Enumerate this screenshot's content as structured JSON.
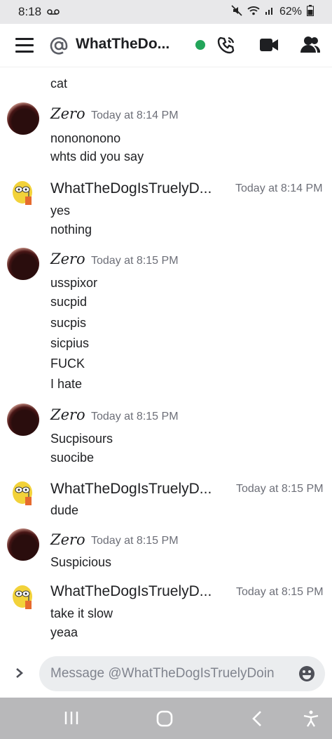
{
  "status": {
    "time": "8:18",
    "battery": "62%",
    "icons": [
      "voicemail-icon",
      "mute-icon",
      "wifi-icon",
      "signal-icon",
      "battery-icon"
    ]
  },
  "header": {
    "title": "WhatTheDo...",
    "status_color": "#23a55a",
    "icons": [
      "menu-icon",
      "at-icon",
      "call-icon",
      "video-icon",
      "members-icon"
    ]
  },
  "partial_top_line": "cat",
  "messages": [
    {
      "username": "Zero",
      "timestamp": "Today at 8:14 PM",
      "lines": [
        "nonononono",
        "whts did you say"
      ]
    },
    {
      "username": "WhatTheDogIsTruelyD...",
      "timestamp": "Today at 8:14 PM",
      "lines": [
        "yes",
        "nothing"
      ]
    },
    {
      "username": "Zero",
      "timestamp": "Today at 8:15 PM",
      "lines": [
        "usspixor",
        "sucpid",
        "sucpis",
        "sicpius",
        "FUCK",
        "I hate"
      ]
    },
    {
      "username": "Zero",
      "timestamp": "Today at 8:15 PM",
      "lines": [
        "Sucpisours",
        "suocibe"
      ]
    },
    {
      "username": "WhatTheDogIsTruelyD...",
      "timestamp": "Today at 8:15 PM",
      "lines": [
        "dude"
      ]
    },
    {
      "username": "Zero",
      "timestamp": "Today at 8:15 PM",
      "lines": [
        "Suspicious"
      ]
    },
    {
      "username": "WhatTheDogIsTruelyD...",
      "timestamp": "Today at 8:15 PM",
      "lines": [
        "take it slow",
        "yeaa"
      ]
    }
  ],
  "composer": {
    "placeholder": "Message @WhatTheDogIsTruelyDoin",
    "icons": [
      "expand-icon",
      "emoji-icon"
    ]
  },
  "navigation": {
    "icons": [
      "recent-apps-icon",
      "home-icon",
      "back-icon",
      "accessibility-icon"
    ]
  }
}
